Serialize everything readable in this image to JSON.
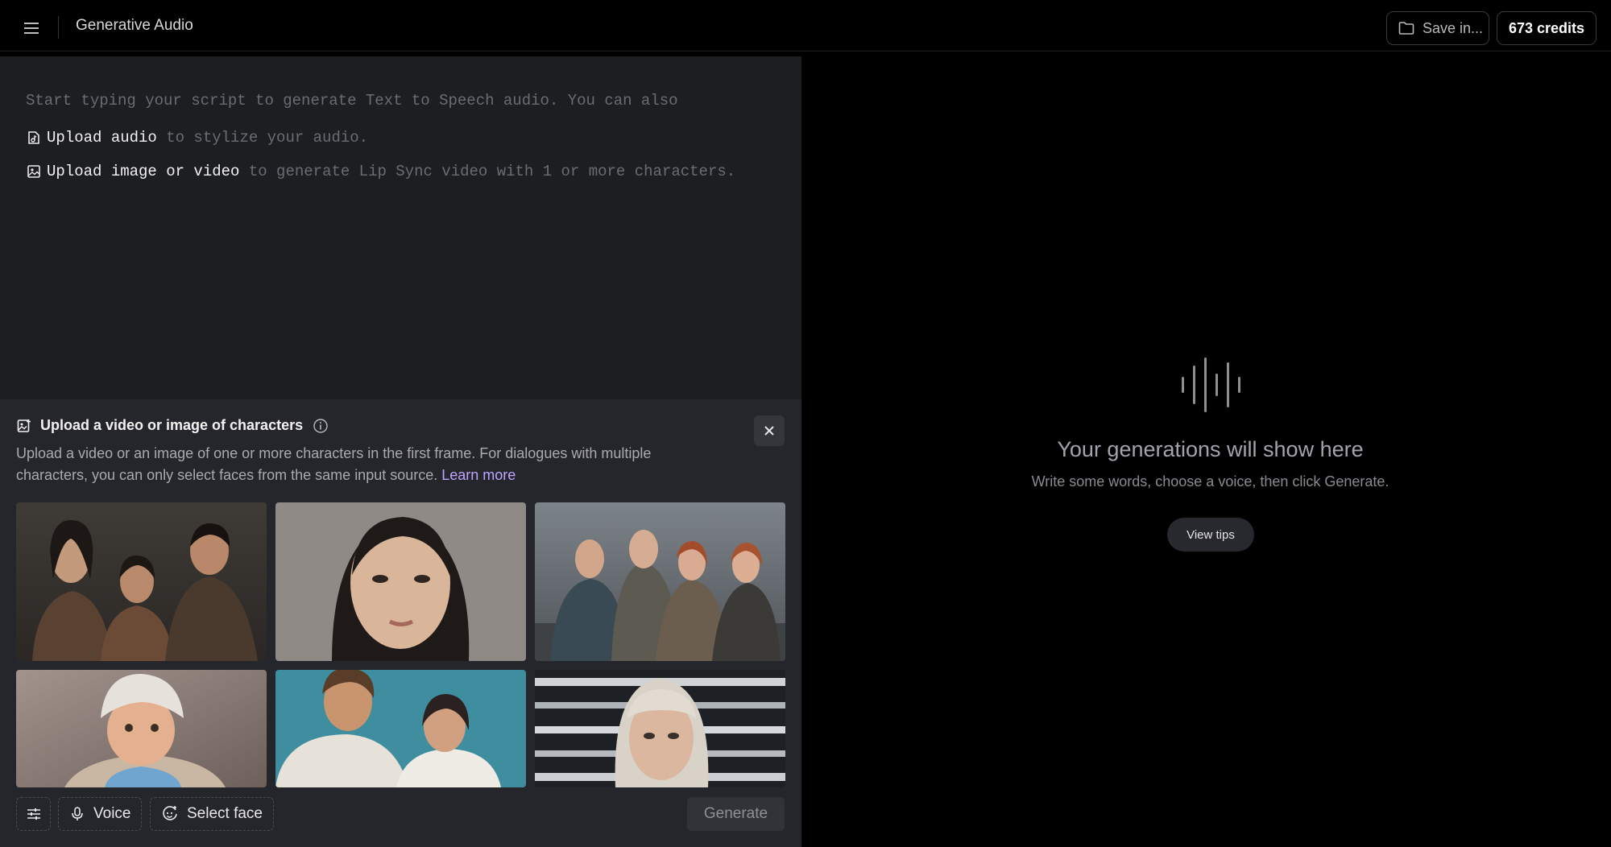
{
  "header": {
    "app_title": "Generative Audio",
    "save_label": "Save in...",
    "credits_label": "673 credits"
  },
  "editor": {
    "placeholder_line1": "Start typing your script to generate Text to Speech audio. You can also",
    "upload_audio_link": "Upload audio",
    "upload_audio_suffix": " to stylize your audio.",
    "upload_image_link": "Upload image or video",
    "upload_image_suffix": " to generate Lip Sync video with 1 or more characters."
  },
  "upload_panel": {
    "title": "Upload a video or image of characters",
    "description": "Upload a video or an image of one or more characters in the first frame. For dialogues with multiple characters, you can only select faces from the same input source.",
    "learn_more": "Learn more",
    "thumbnails": [
      {
        "subject": "three-people-dark-clothes"
      },
      {
        "subject": "woman-portrait-closeup"
      },
      {
        "subject": "four-friends-outdoors"
      },
      {
        "subject": "child-winter-hat"
      },
      {
        "subject": "couple-blue-backdrop"
      },
      {
        "subject": "woman-platinum-bob"
      }
    ]
  },
  "toolbar": {
    "voice_label": "Voice",
    "select_face_label": "Select face",
    "generate_label": "Generate"
  },
  "output": {
    "empty_title": "Your generations will show here",
    "empty_subtitle": "Write some words, choose a voice, then click Generate.",
    "tips_label": "View tips"
  },
  "colors": {
    "accent_link": "#bfa6ff",
    "editor_bg": "#1d1e22",
    "panel_bg": "#25262b"
  }
}
